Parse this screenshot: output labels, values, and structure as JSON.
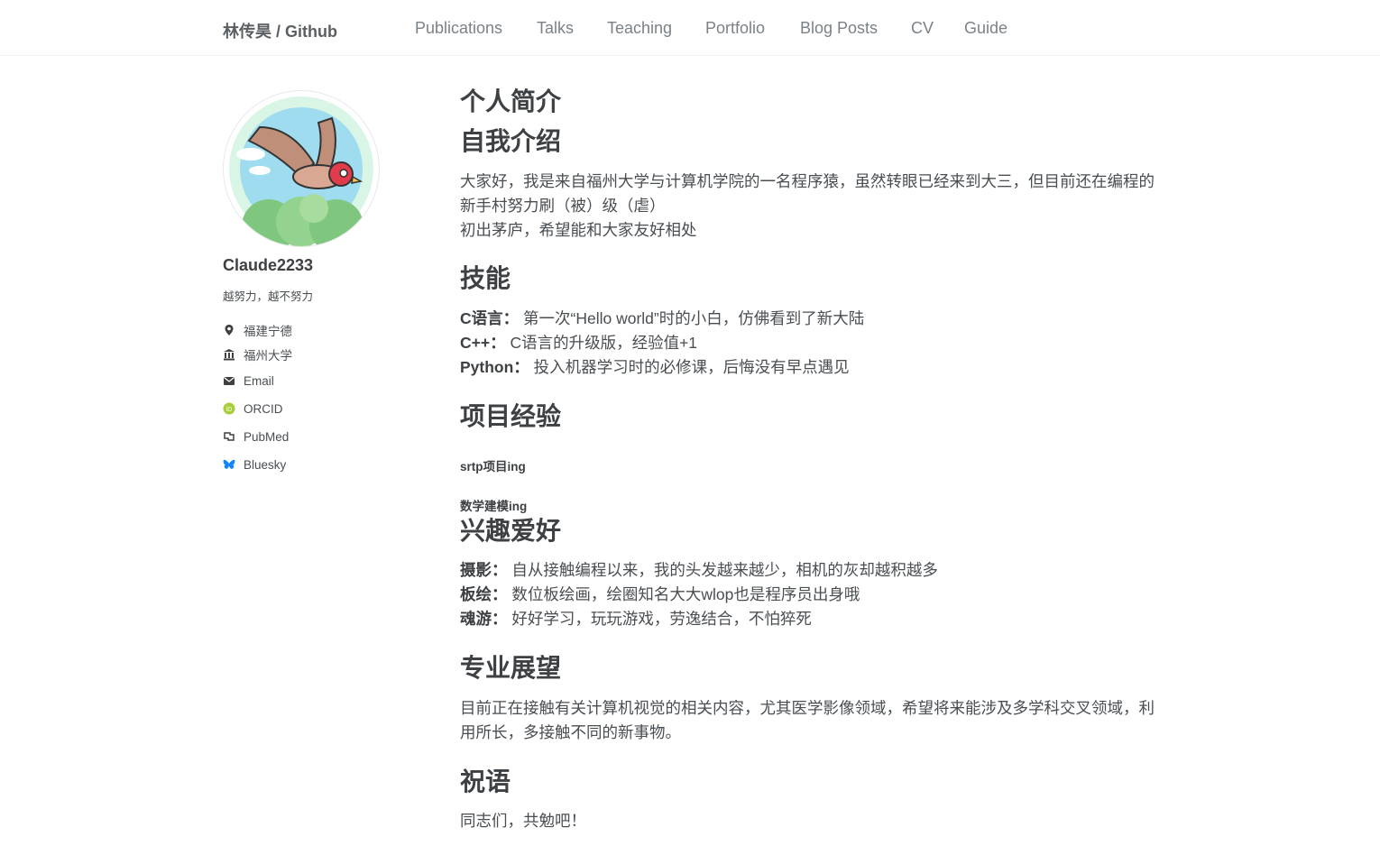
{
  "site": {
    "title": "林传昊 / Github",
    "nav": [
      "Publications",
      "Talks",
      "Teaching",
      "Portfolio",
      "Blog Posts",
      "CV",
      "Guide"
    ]
  },
  "sidebar": {
    "name": "Claude2233",
    "bio": "越努力，越不努力",
    "links": [
      {
        "icon": "location-pin-icon",
        "label": "福建宁德"
      },
      {
        "icon": "university-icon",
        "label": "福州大学"
      },
      {
        "icon": "envelope-icon",
        "label": "Email"
      },
      {
        "icon": "orcid-icon",
        "label": "ORCID"
      },
      {
        "icon": "pubmed-icon",
        "label": "PubMed"
      },
      {
        "icon": "bluesky-icon",
        "label": "Bluesky"
      }
    ]
  },
  "main": {
    "h_profile": "个人简介",
    "h_intro": "自我介绍",
    "intro_line1": "大家好，我是来自福州大学与计算机学院的一名程序猿，虽然转眼已经来到大三，但目前还在编程的新手村努力刷（被）级（虐）",
    "intro_line2": "初出茅庐，希望能和大家友好相处",
    "h_skills": "技能",
    "skills": [
      {
        "label": "C语言：",
        "text": " 第一次“Hello world”时的小白，仿佛看到了新大陆"
      },
      {
        "label": "C++：",
        "text": " C语言的升级版，经验值+1"
      },
      {
        "label": "Python：",
        "text": " 投入机器学习时的必修课，后悔没有早点遇见"
      }
    ],
    "h_projects": "项目经验",
    "projects": [
      "srtp项目ing",
      "数学建模ing"
    ],
    "h_hobbies": "兴趣爱好",
    "hobbies": [
      {
        "label": "摄影：",
        "text": " 自从接触编程以来，我的头发越来越少，相机的灰却越积越多"
      },
      {
        "label": "板绘：",
        "text": " 数位板绘画，绘圈知名大大wlop也是程序员出身哦"
      },
      {
        "label": "魂游：",
        "text": " 好好学习，玩玩游戏，劳逸结合，不怕猝死"
      }
    ],
    "h_outlook": "专业展望",
    "outlook": "目前正在接触有关计算机视觉的相关内容，尤其医学影像领域，希望将来能涉及多学科交叉领域，利用所长，多接触不同的新事物。",
    "h_wish": "祝语",
    "wish": "同志们，共勉吧！"
  }
}
